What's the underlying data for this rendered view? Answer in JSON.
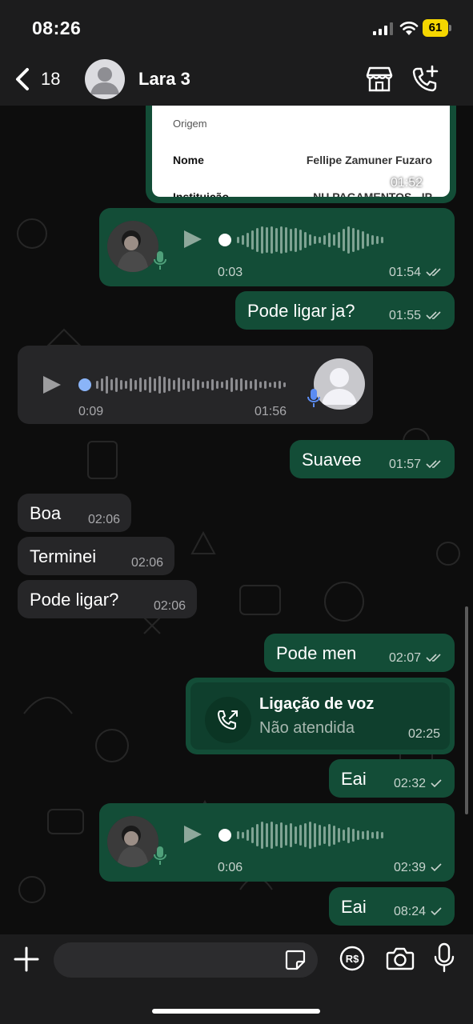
{
  "status_bar": {
    "time": "08:26",
    "battery": "61"
  },
  "header": {
    "back_count": "18",
    "contact_name": "Lara 3"
  },
  "receipt": {
    "origin_label": "Origem",
    "name_label": "Nome",
    "name_value": "Fellipe Zamuner Fuzaro",
    "institution_label": "Instituição",
    "institution_value": "NU PAGAMENTOS - IP",
    "time": "01:52"
  },
  "messages": [
    {
      "kind": "voice-out",
      "duration": "0:03",
      "time": "01:54"
    },
    {
      "kind": "text-out",
      "text": "Pode ligar ja?",
      "time": "01:55"
    },
    {
      "kind": "voice-in",
      "duration": "0:09",
      "time": "01:56"
    },
    {
      "kind": "text-out",
      "text": "Suavee",
      "time": "01:57"
    },
    {
      "kind": "text-in",
      "text": "Boa",
      "time": "02:06"
    },
    {
      "kind": "text-in",
      "text": "Terminei",
      "time": "02:06"
    },
    {
      "kind": "text-in",
      "text": "Pode ligar?",
      "time": "02:06"
    },
    {
      "kind": "text-out",
      "text": "Pode men",
      "time": "02:07"
    },
    {
      "kind": "call",
      "title": "Ligação de voz",
      "subtitle": "Não atendida",
      "time": "02:25"
    },
    {
      "kind": "text-out",
      "text": "Eai",
      "time": "02:32"
    },
    {
      "kind": "voice-out",
      "duration": "0:06",
      "time": "02:39"
    },
    {
      "kind": "text-out",
      "text": "Eai",
      "time": "08:24"
    }
  ],
  "input_bar": {
    "placeholder": ""
  },
  "colors": {
    "outgoing_bubble": "#134d37",
    "incoming_bubble": "#262628",
    "read_tick": "#c7d3cd"
  },
  "icons": [
    "back-chevron-icon",
    "store-icon",
    "call-add-icon",
    "plus-icon",
    "sticker-icon",
    "pay-icon",
    "camera-icon",
    "mic-icon"
  ]
}
